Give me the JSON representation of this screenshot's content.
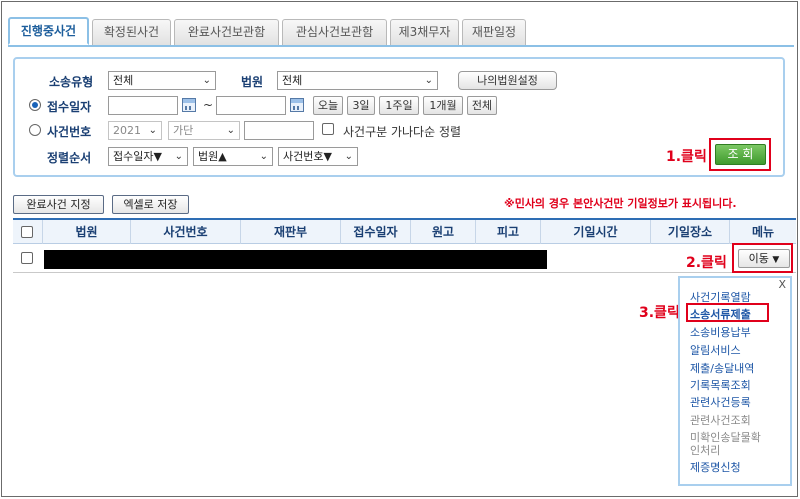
{
  "tabs": [
    {
      "label": "진행중사건",
      "active": true
    },
    {
      "label": "확정된사건",
      "active": false
    },
    {
      "label": "완료사건보관함",
      "active": false
    },
    {
      "label": "관심사건보관함",
      "active": false
    },
    {
      "label": "제3채무자",
      "active": false
    },
    {
      "label": "재판일정",
      "active": false
    }
  ],
  "search": {
    "case_type_label": "소송유형",
    "case_type_value": "전체",
    "court_label": "법원",
    "court_value": "전체",
    "my_court_button": "나의법원설정",
    "receipt_date_label": "접수일자",
    "date_sep": "~",
    "quick_today": "오늘",
    "quick_3days": "3일",
    "quick_1week": "1주일",
    "quick_1month": "1개월",
    "quick_all": "전체",
    "case_no_label": "사건번호",
    "year_value": "2021",
    "case_kind_value": "가단",
    "sort_checkbox_label": "사건구분 가나다순 정렬",
    "sort_label": "정렬순서",
    "sort1": "접수일자▼",
    "sort2": "법원▲",
    "sort3": "사건번호▼",
    "search_button": "조 회"
  },
  "annotations": {
    "step1": "1.클릭",
    "step2": "2.클릭",
    "step3": "3.클릭"
  },
  "actions": {
    "mark_complete": "완료사건 지정",
    "save_excel": "엑셀로 저장",
    "notice": "※민사의 경우 본안사건만 기일정보가 표시됩니다."
  },
  "table": {
    "headers": [
      "법원",
      "사건번호",
      "재판부",
      "접수일자",
      "원고",
      "피고",
      "기일시간",
      "기일장소",
      "메뉴"
    ],
    "row_menu_button": "이동"
  },
  "menu": {
    "close": "X",
    "items": [
      "사건기록열람",
      "소송서류제출",
      "소송비용납부",
      "알림서비스",
      "제출/송달내역",
      "기록목록조회",
      "관련사건등록",
      "관련사건조회",
      "미확인송달물확인처리",
      "제증명신청"
    ]
  },
  "colors": {
    "accent": "#2e6db4",
    "annotation_red": "#e0001b",
    "search_green": "#4aa834"
  }
}
